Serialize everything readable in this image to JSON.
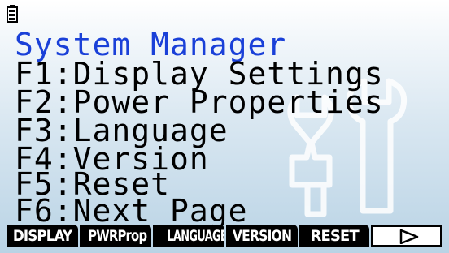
{
  "status_bar": {
    "icon": "battery-icon"
  },
  "menu": {
    "title": "System Manager",
    "items": [
      {
        "label": "F1:Display Settings"
      },
      {
        "label": "F2:Power Properties"
      },
      {
        "label": "F3:Language"
      },
      {
        "label": "F4:Version"
      },
      {
        "label": "F5:Reset"
      },
      {
        "label": "F6:Next Page"
      }
    ]
  },
  "function_keys": [
    {
      "label": "DISPLAY"
    },
    {
      "label": "PWRProp"
    },
    {
      "label": "LANGUAGE"
    },
    {
      "label": "VERSION"
    },
    {
      "label": "RESET"
    },
    {
      "label": "",
      "icon": "play-triangle-icon"
    }
  ],
  "colors": {
    "title": "#1a40d8",
    "text": "#000000",
    "background_top": "#ffffff",
    "background_bottom": "#b9d3e5",
    "fkey_background": "#000000",
    "fkey_text": "#ffffff"
  },
  "background_art": {
    "icon": "wrench-tools-icon"
  }
}
